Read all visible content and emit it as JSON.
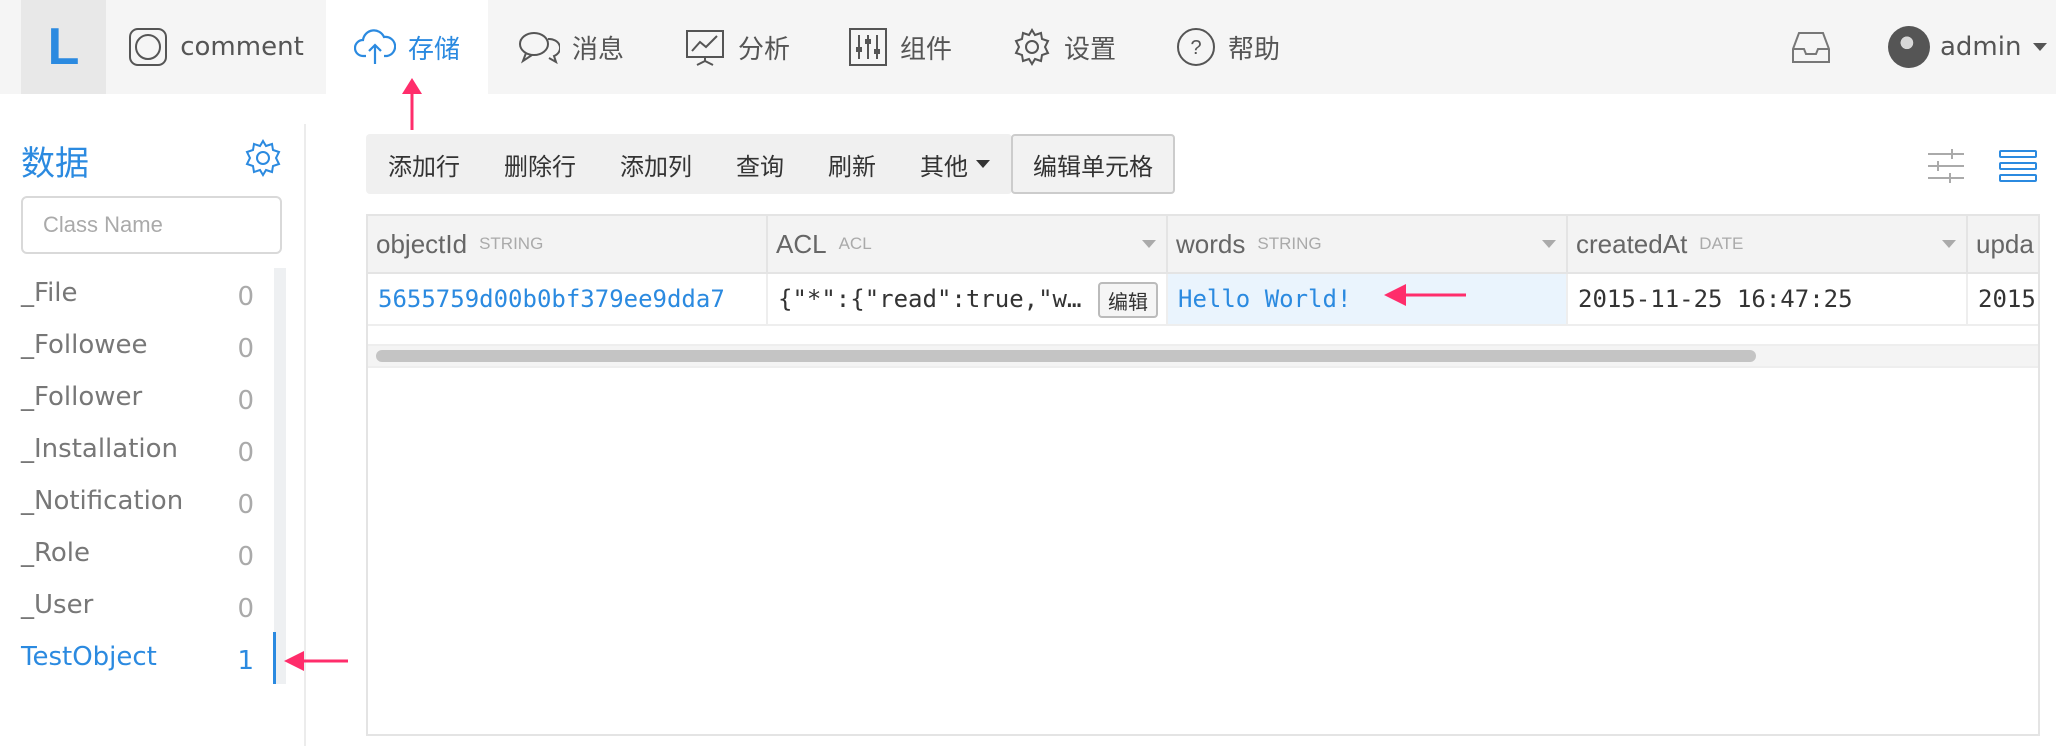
{
  "nav": {
    "logo": "L",
    "items": [
      {
        "label": "comment",
        "icon": "app-icon"
      },
      {
        "label": "存储",
        "icon": "cloud-upload-icon",
        "active": true
      },
      {
        "label": "消息",
        "icon": "chat-icon"
      },
      {
        "label": "分析",
        "icon": "chart-icon"
      },
      {
        "label": "组件",
        "icon": "sliders-icon"
      },
      {
        "label": "设置",
        "icon": "gear-icon"
      },
      {
        "label": "帮助",
        "icon": "help-icon"
      }
    ],
    "user": "admin"
  },
  "sidebar": {
    "title": "数据",
    "search_placeholder": "Class Name",
    "classes": [
      {
        "name": "_File",
        "count": "0"
      },
      {
        "name": "_Followee",
        "count": "0"
      },
      {
        "name": "_Follower",
        "count": "0"
      },
      {
        "name": "_Installation",
        "count": "0"
      },
      {
        "name": "_Notification",
        "count": "0"
      },
      {
        "name": "_Role",
        "count": "0"
      },
      {
        "name": "_User",
        "count": "0"
      },
      {
        "name": "TestObject",
        "count": "1",
        "active": true
      }
    ]
  },
  "toolbar": {
    "buttons": [
      "添加行",
      "删除行",
      "添加列",
      "查询",
      "刷新",
      "其他"
    ],
    "edit_cell": "编辑单元格"
  },
  "grid": {
    "columns": [
      {
        "name": "objectId",
        "type": "STRING"
      },
      {
        "name": "ACL",
        "type": "ACL"
      },
      {
        "name": "words",
        "type": "STRING"
      },
      {
        "name": "createdAt",
        "type": "DATE"
      },
      {
        "name": "upda",
        "type": ""
      }
    ],
    "row": {
      "objectId": "5655759d00b0bf379ee9dda7",
      "acl": "{\"*\":{\"read\":true,\"w…",
      "acl_edit": "编辑",
      "words": "Hello World!",
      "createdAt": "2015-11-25 16:47:25",
      "updatedAt": "2015"
    }
  },
  "colors": {
    "accent": "#2b8ae0",
    "annotation": "#ff2d6b"
  }
}
